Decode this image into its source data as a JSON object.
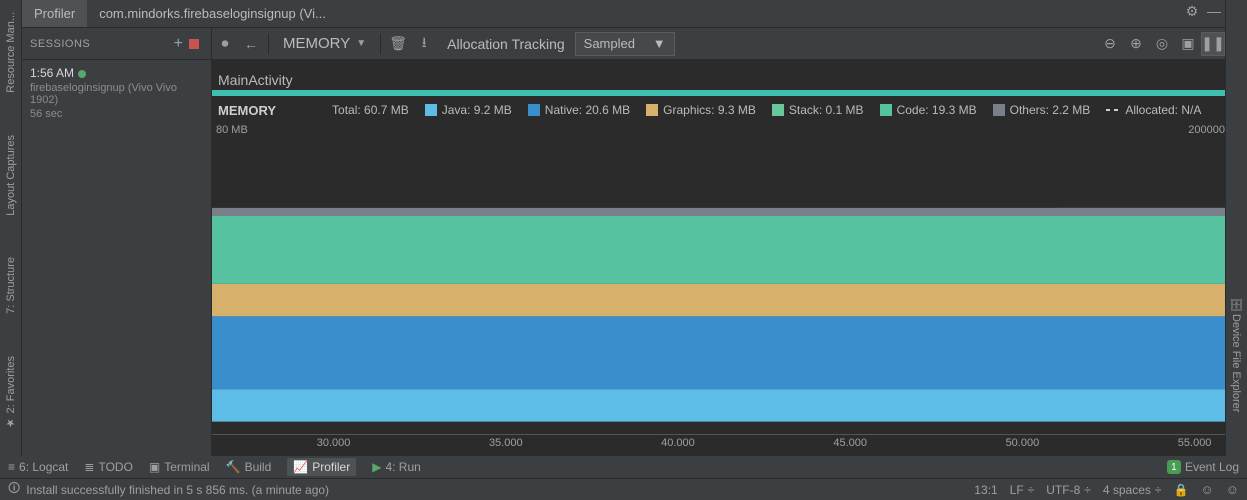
{
  "tabs": {
    "profiler": "Profiler",
    "app": "com.mindorks.firebaseloginsignup (Vi..."
  },
  "sessions": {
    "header": "SESSIONS",
    "item": {
      "time": "1:56 AM",
      "device": "firebaseloginsignup (Vivo Vivo 1902)",
      "duration": "56 sec"
    }
  },
  "toolbar": {
    "memory": "MEMORY",
    "allocation": "Allocation Tracking",
    "sampled": "Sampled"
  },
  "activity": "MainActivity",
  "legend": {
    "title": "MEMORY",
    "total": "Total: 60.7 MB",
    "java": "Java: 9.2 MB",
    "native": "Native: 20.6 MB",
    "graphics": "Graphics: 9.3 MB",
    "stack": "Stack: 0.1 MB",
    "code": "Code: 19.3 MB",
    "others": "Others: 2.2 MB",
    "allocated": "Allocated: N/A"
  },
  "axes": {
    "ytop": "80 MB",
    "yright": "200000",
    "xticks": [
      "30.000",
      "35.000",
      "40.000",
      "45.000",
      "50.000",
      "55.000"
    ]
  },
  "bottom": {
    "logcat": "6: Logcat",
    "todo": "TODO",
    "terminal": "Terminal",
    "build": "Build",
    "profiler": "Profiler",
    "run": "4: Run",
    "eventlog": "Event Log"
  },
  "status": {
    "msg": "Install successfully finished in 5 s 856 ms. (a minute ago)",
    "caret": "13:1",
    "lineend": "LF",
    "encoding": "UTF-8",
    "indent": "4 spaces"
  },
  "leftstrip": {
    "resman": "Resource Man...",
    "layout": "Layout Captures",
    "structure": "7: Structure",
    "favorites": "2: Favorites"
  },
  "rightstrip": {
    "device": "Device File Explorer"
  },
  "chart_data": {
    "type": "area",
    "x_range": [
      28,
      56
    ],
    "y_max_mb": 80,
    "secondary_y_max": 200000,
    "xticks": [
      30,
      35,
      40,
      45,
      50,
      55
    ],
    "series": [
      {
        "name": "Java",
        "color": "#5dbde6",
        "value_mb": 9.2
      },
      {
        "name": "Native",
        "color": "#3a8ecb",
        "value_mb": 20.6
      },
      {
        "name": "Graphics",
        "color": "#d7b16b",
        "value_mb": 9.3
      },
      {
        "name": "Stack",
        "color": "#cfa75a",
        "value_mb": 0.1
      },
      {
        "name": "Code",
        "color": "#57c2a0",
        "value_mb": 19.3
      },
      {
        "name": "Others",
        "color": "#7a8089",
        "value_mb": 2.2
      }
    ],
    "total_mb": 60.7,
    "activity": "MainActivity"
  }
}
